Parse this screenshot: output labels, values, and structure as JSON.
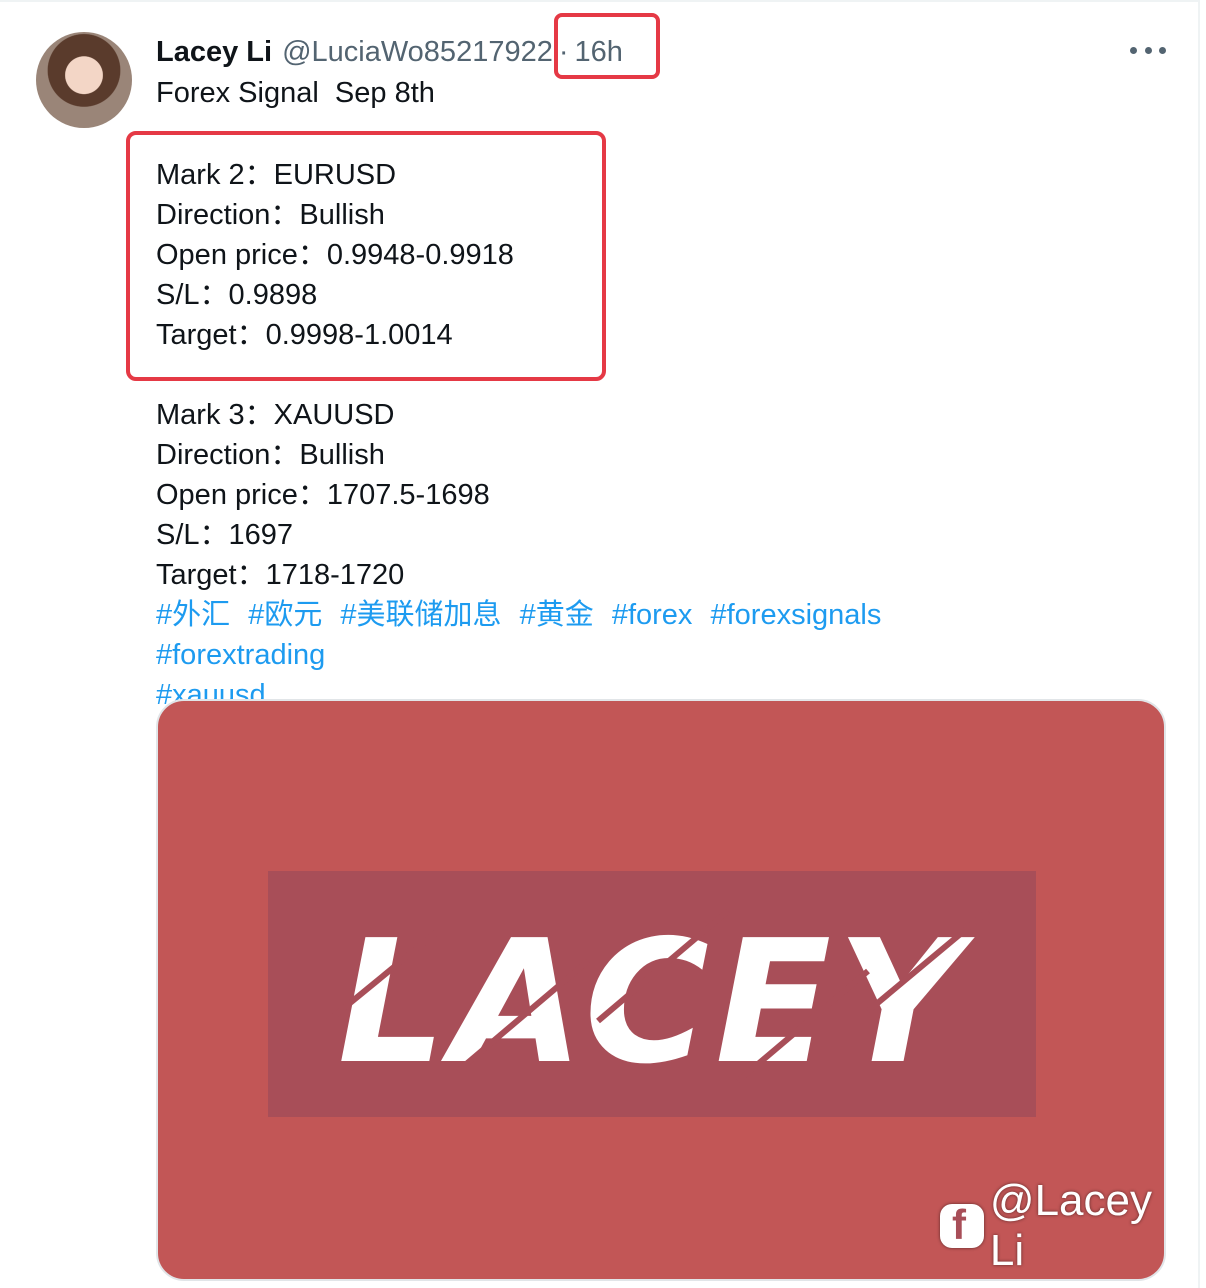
{
  "tweet": {
    "author_name": "Lacey Li",
    "author_handle": "@LuciaWo85217922",
    "separator": "·",
    "time": "16h",
    "title": "Forex Signal  Sep 8th",
    "signal1": [
      "Mark 2：EURUSD",
      "Direction：Bullish",
      "Open price：0.9948-0.9918",
      "S/L：0.9898",
      "Target：0.9998-1.0014"
    ],
    "signal2": [
      "Mark 3：XAUUSD",
      "Direction：Bullish",
      "Open price：1707.5-1698",
      "S/L：1697",
      "Target：1718-1720"
    ],
    "hashtags": [
      "#外汇",
      "#欧元",
      "#美联储加息",
      "#黄金",
      "#forex",
      "#forexsignals",
      "#forextrading",
      "#xauusd"
    ]
  },
  "media": {
    "logo_text": "LACEY",
    "background_color": "#c25656",
    "band_color": "#a84e58"
  },
  "watermark": {
    "icon": "app-logo-icon",
    "text": "@Lacey Li"
  },
  "icons": {
    "more": "more-options-icon"
  }
}
